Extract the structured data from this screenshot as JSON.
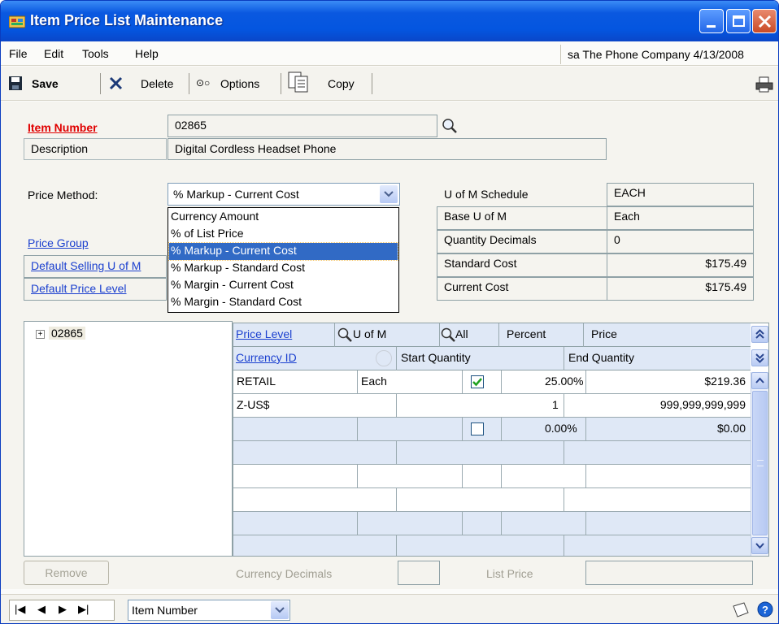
{
  "window": {
    "title": "Item Price List Maintenance"
  },
  "menu": {
    "file": "File",
    "edit": "Edit",
    "tools": "Tools",
    "help": "Help",
    "company_info": "sa  The Phone Company  4/13/2008"
  },
  "toolbar": {
    "save": "Save",
    "delete": "Delete",
    "options": "Options",
    "copy": "Copy"
  },
  "item": {
    "number_label": "Item Number",
    "number_value": "02865",
    "description_label": "Description",
    "description_value": "Digital Cordless Headset Phone"
  },
  "price_method": {
    "label": "Price Method:",
    "selected": "% Markup - Current Cost",
    "options": [
      "Currency Amount",
      "% of List Price",
      "% Markup - Current Cost",
      "% Markup - Standard Cost",
      "% Margin - Current Cost",
      "% Margin - Standard Cost"
    ]
  },
  "links": {
    "price_group": "Price Group",
    "default_selling_uom": "Default Selling U of M",
    "default_price_level": "Default Price Level"
  },
  "info": {
    "uom_schedule_label": "U of M Schedule",
    "uom_schedule_value": "EACH",
    "base_uom_label": "Base U of M",
    "base_uom_value": "Each",
    "qty_decimals_label": "Quantity Decimals",
    "qty_decimals_value": "0",
    "standard_cost_label": "Standard Cost",
    "standard_cost_value": "$175.49",
    "current_cost_label": "Current Cost",
    "current_cost_value": "$175.49"
  },
  "tree": {
    "root": "02865"
  },
  "grid": {
    "headers": {
      "price_level": "Price Level",
      "uom": "U of M",
      "all": "All",
      "percent": "Percent",
      "price": "Price",
      "currency_id": "Currency ID",
      "start_quantity": "Start Quantity",
      "end_quantity": "End Quantity"
    },
    "row1": {
      "price_level": "RETAIL",
      "uom": "Each",
      "checked": true,
      "percent": "25.00%",
      "price": "$219.36"
    },
    "row2": {
      "currency_id": "Z-US$",
      "start_quantity": "1",
      "end_quantity": "999,999,999,999"
    },
    "row3": {
      "checked": false,
      "percent": "0.00%",
      "price": "$0.00"
    }
  },
  "bottom": {
    "remove": "Remove",
    "currency_decimals": "Currency Decimals",
    "list_price": "List Price"
  },
  "statusbar": {
    "sort_by": "Item Number"
  }
}
